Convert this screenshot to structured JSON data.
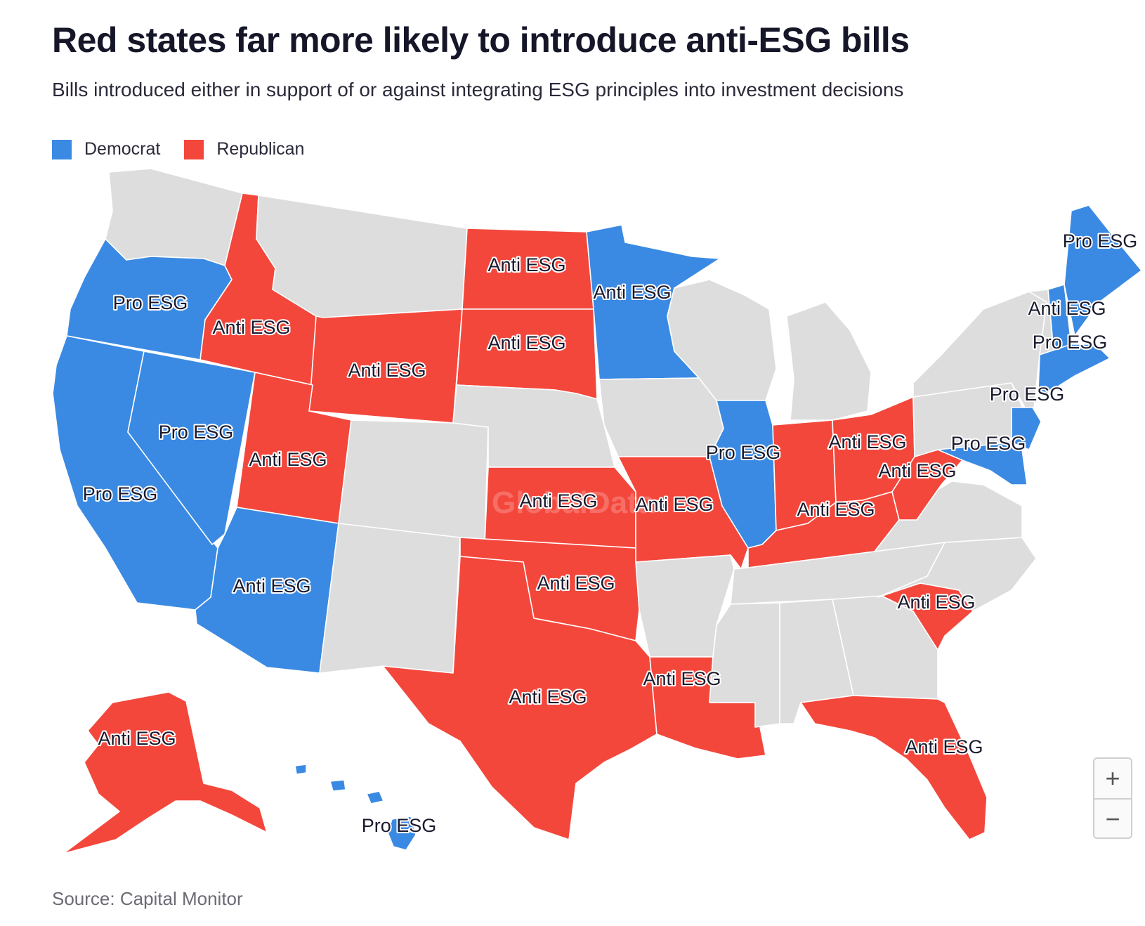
{
  "title": "Red states far more likely to introduce anti-ESG bills",
  "subtitle": "Bills introduced either in support of or against integrating ESG principles into investment decisions",
  "legend": [
    {
      "label": "Democrat",
      "color": "#3a8ae3"
    },
    {
      "label": "Republican",
      "color": "#f4473c"
    }
  ],
  "colors": {
    "democrat": "#3a8ae3",
    "republican": "#f4473c",
    "none": "#dddddd"
  },
  "watermark": "GlobalData",
  "states": {
    "washington": {
      "party": "none"
    },
    "oregon": {
      "party": "democrat",
      "label": "Pro ESG"
    },
    "california": {
      "party": "democrat",
      "label": "Pro ESG"
    },
    "nevada": {
      "party": "democrat",
      "label": "Pro ESG"
    },
    "idaho": {
      "party": "republican",
      "label": "Anti ESG"
    },
    "montana": {
      "party": "none"
    },
    "wyoming": {
      "party": "republican",
      "label": "Anti ESG"
    },
    "utah": {
      "party": "republican",
      "label": "Anti ESG"
    },
    "arizona": {
      "party": "democrat",
      "label": "Anti ESG"
    },
    "colorado": {
      "party": "none"
    },
    "new_mexico": {
      "party": "none"
    },
    "north_dakota": {
      "party": "republican",
      "label": "Anti ESG"
    },
    "south_dakota": {
      "party": "republican",
      "label": "Anti ESG"
    },
    "nebraska": {
      "party": "none"
    },
    "kansas": {
      "party": "republican",
      "label": "Anti ESG"
    },
    "oklahoma": {
      "party": "republican",
      "label": "Anti ESG"
    },
    "texas": {
      "party": "republican",
      "label": "Anti ESG"
    },
    "minnesota": {
      "party": "democrat",
      "label": "Anti ESG"
    },
    "iowa": {
      "party": "none"
    },
    "missouri": {
      "party": "republican",
      "label": "Anti ESG"
    },
    "arkansas": {
      "party": "none"
    },
    "louisiana": {
      "party": "republican",
      "label": "Anti ESG"
    },
    "wisconsin": {
      "party": "none"
    },
    "illinois": {
      "party": "democrat",
      "label": "Pro ESG"
    },
    "michigan": {
      "party": "none"
    },
    "indiana": {
      "party": "republican",
      "label": "Anti ESG"
    },
    "ohio": {
      "party": "republican",
      "label": "Anti ESG"
    },
    "kentucky": {
      "party": "republican",
      "label": "Anti ESG"
    },
    "tennessee": {
      "party": "none"
    },
    "mississippi": {
      "party": "none"
    },
    "alabama": {
      "party": "none"
    },
    "georgia": {
      "party": "none"
    },
    "florida": {
      "party": "republican",
      "label": "Anti ESG"
    },
    "south_carolina": {
      "party": "republican",
      "label": "Anti ESG"
    },
    "north_carolina": {
      "party": "none"
    },
    "virginia": {
      "party": "none"
    },
    "west_virginia": {
      "party": "republican",
      "label": "Anti ESG"
    },
    "pennsylvania": {
      "party": "none"
    },
    "new_york": {
      "party": "none"
    },
    "new_jersey": {
      "party": "democrat",
      "label": "Pro ESG"
    },
    "maryland_delaware": {
      "party": "democrat",
      "label": "Pro ESG"
    },
    "vermont": {
      "party": "none"
    },
    "new_hampshire": {
      "party": "democrat",
      "label": "Anti ESG"
    },
    "maine": {
      "party": "democrat",
      "label": "Pro ESG"
    },
    "massachusetts_ct_ri": {
      "party": "democrat",
      "label": "Pro ESG"
    },
    "alaska": {
      "party": "republican",
      "label": "Anti ESG"
    },
    "hawaii": {
      "party": "democrat",
      "label": "Pro ESG"
    }
  },
  "zoom": {
    "in": "+",
    "out": "−"
  },
  "source": "Source: Capital Monitor"
}
